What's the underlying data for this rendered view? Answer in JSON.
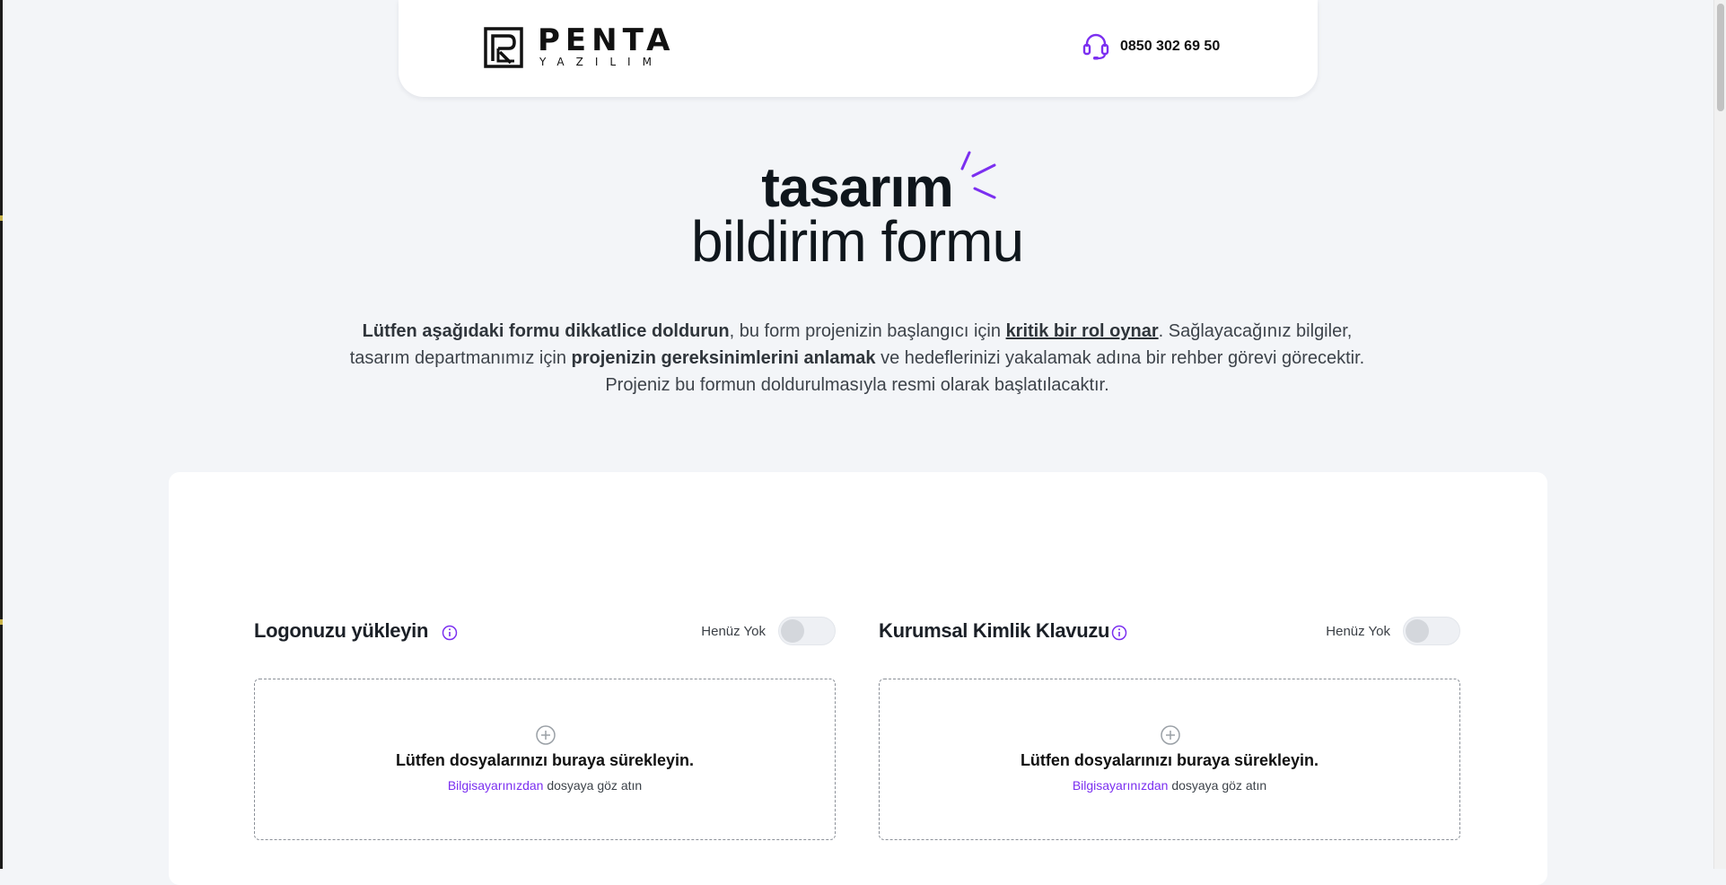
{
  "header": {
    "logo_name": "PENTA",
    "logo_sub": "YAZILIM",
    "phone": "0850 302 69 50"
  },
  "hero": {
    "line1": "tasarım",
    "line2": "bildirim formu"
  },
  "intro": {
    "p1_bold": "Lütfen aşağıdaki formu dikkatlice doldurun",
    "p2": ", bu form projenizin başlangıcı için ",
    "p3_underline": "kritik bir rol oynar",
    "p4": ". Sağlayacağınız bilgiler, tasarım departmanımız için ",
    "p5_bold": "projenizin gereksinimlerini anlamak",
    "p6": " ve hedeflerinizi yakalamak adına bir rehber görevi görecektir. Projeniz bu formun doldurulmasıyla resmi olarak başlatılacaktır."
  },
  "sections": [
    {
      "title": "Logonuzu yükleyin",
      "toggle_label": "Henüz Yok",
      "toggle_on": false,
      "drop_title": "Lütfen dosyalarınızı buraya sürekleyin.",
      "drop_link": "Bilgisayarınızdan",
      "drop_rest": " dosyaya göz atın"
    },
    {
      "title": "Kurumsal Kimlik Klavuzu",
      "toggle_label": "Henüz Yok",
      "toggle_on": false,
      "drop_title": "Lütfen dosyalarınızı buraya sürekleyin.",
      "drop_link": "Bilgisayarınızdan",
      "drop_rest": " dosyaya göz atın"
    }
  ],
  "colors": {
    "accent": "#7b2ff0",
    "background": "#f3f5f8",
    "card": "#ffffff"
  }
}
